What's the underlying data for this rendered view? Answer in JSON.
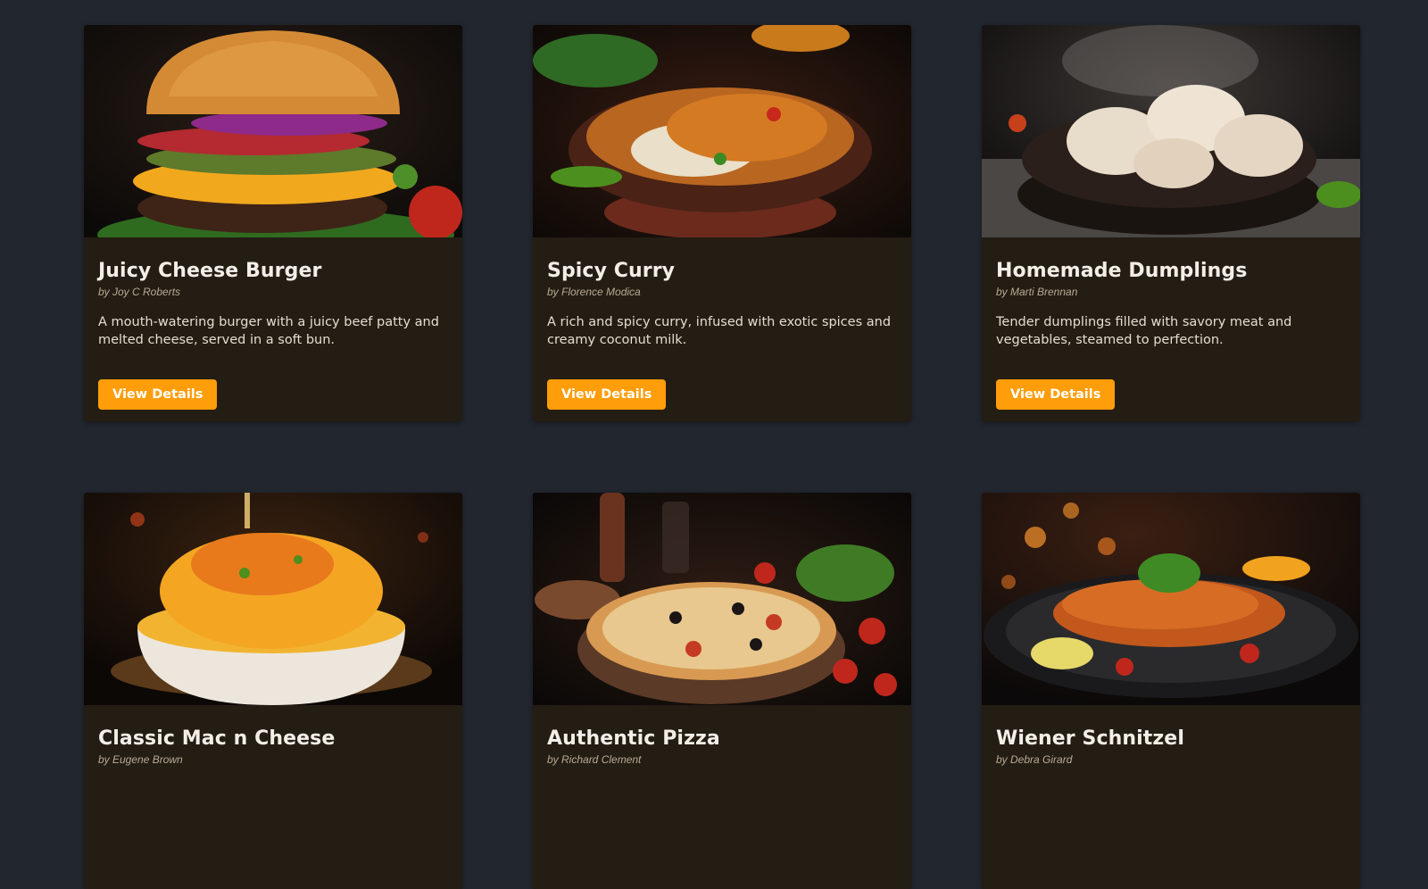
{
  "recipes": [
    {
      "title": "Juicy Cheese Burger",
      "author": "by Joy C Roberts",
      "description": "A mouth-watering burger with a juicy beef patty and melted cheese, served in a soft bun.",
      "button_label": "View Details",
      "image": "burger-photo"
    },
    {
      "title": "Spicy Curry",
      "author": "by Florence Modica",
      "description": "A rich and spicy curry, infused with exotic spices and creamy coconut milk.",
      "button_label": "View Details",
      "image": "curry-photo"
    },
    {
      "title": "Homemade Dumplings",
      "author": "by Marti Brennan",
      "description": "Tender dumplings filled with savory meat and vegetables, steamed to perfection.",
      "button_label": "View Details",
      "image": "dumplings-photo"
    },
    {
      "title": "Classic Mac n Cheese",
      "author": "by Eugene Brown",
      "image": "mac-n-cheese-photo"
    },
    {
      "title": "Authentic Pizza",
      "author": "by Richard Clement",
      "image": "pizza-photo"
    },
    {
      "title": "Wiener Schnitzel",
      "author": "by Debra Girard",
      "image": "schnitzel-photo"
    }
  ],
  "colors": {
    "page_background": "#22262e",
    "card_background": "#241d13",
    "button_accent": "#ff9d0a"
  }
}
